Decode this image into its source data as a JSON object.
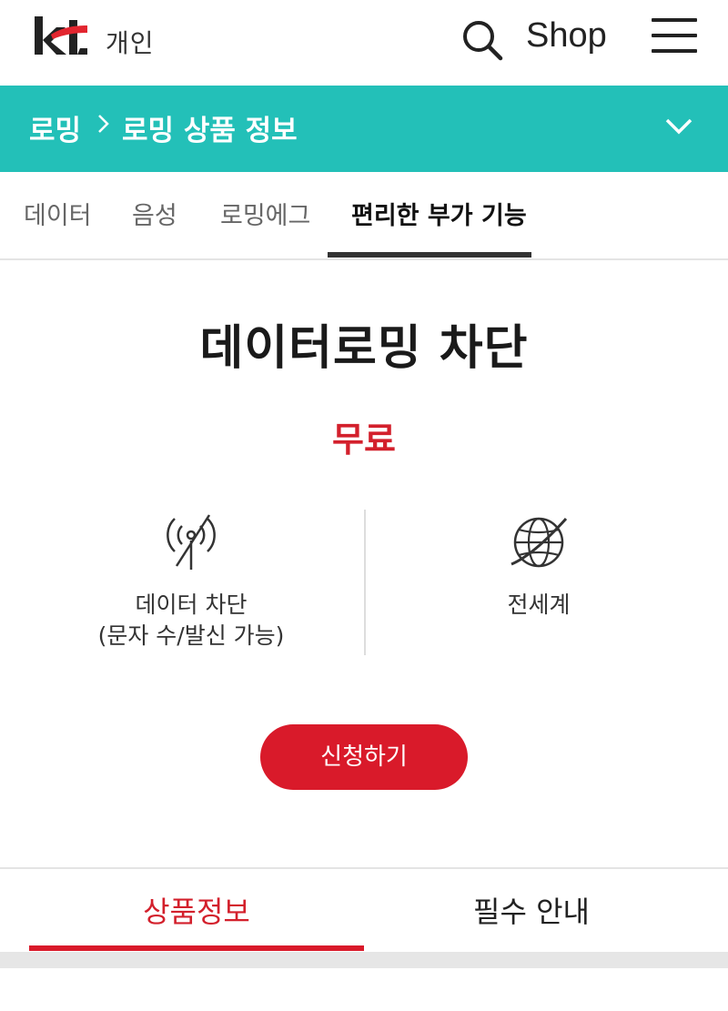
{
  "header": {
    "logo_text": "kt",
    "logo_subtitle": "개인",
    "shop_label": "Shop"
  },
  "breadcrumb": {
    "items": [
      "로밍",
      "로밍 상품 정보"
    ]
  },
  "tabs": [
    {
      "label": "데이터",
      "active": false
    },
    {
      "label": "음성",
      "active": false
    },
    {
      "label": "로밍에그",
      "active": false
    },
    {
      "label": "편리한 부가 기능",
      "active": true
    }
  ],
  "product": {
    "title": "데이터로밍 차단",
    "price": "무료",
    "features": [
      {
        "icon": "blocked-signal-icon",
        "label_line1": "데이터 차단",
        "label_line2": "(문자 수/발신 가능)"
      },
      {
        "icon": "globe-icon",
        "label_line1": "전세계",
        "label_line2": ""
      }
    ],
    "apply_label": "신청하기"
  },
  "bottom_tabs": [
    {
      "label": "상품정보",
      "active": true
    },
    {
      "label": "필수 안내",
      "active": false
    }
  ],
  "colors": {
    "accent_teal": "#23c0b8",
    "accent_red": "#d3202c",
    "button_red": "#d91a2a",
    "logo_red": "#e2252f"
  }
}
